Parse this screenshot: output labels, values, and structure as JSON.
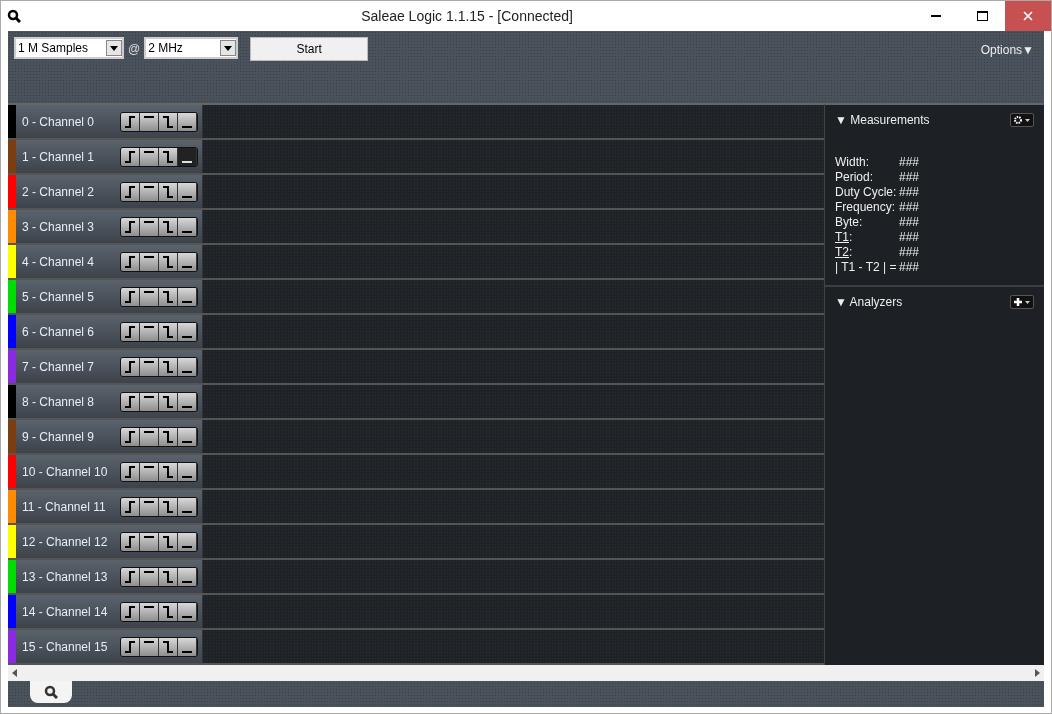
{
  "window": {
    "title": "Saleae Logic 1.1.15 - [Connected]"
  },
  "toolbar": {
    "samples": "1 M Samples",
    "at": "@",
    "rate": "2 MHz",
    "start": "Start",
    "options": "Options▼"
  },
  "channels": [
    {
      "label": "0 - Channel 0",
      "color": "#000000",
      "triggers": [
        false,
        false,
        false,
        false
      ]
    },
    {
      "label": "1 - Channel 1",
      "color": "#7a3e12",
      "triggers": [
        false,
        false,
        false,
        true
      ]
    },
    {
      "label": "2 - Channel 2",
      "color": "#ff0000",
      "triggers": [
        false,
        false,
        false,
        false
      ]
    },
    {
      "label": "3 - Channel 3",
      "color": "#ff8c00",
      "triggers": [
        false,
        false,
        false,
        false
      ]
    },
    {
      "label": "4 - Channel 4",
      "color": "#ffff00",
      "triggers": [
        false,
        false,
        false,
        false
      ]
    },
    {
      "label": "5 - Channel 5",
      "color": "#00dd00",
      "triggers": [
        false,
        false,
        false,
        false
      ]
    },
    {
      "label": "6 - Channel 6",
      "color": "#0000ff",
      "triggers": [
        false,
        false,
        false,
        false
      ]
    },
    {
      "label": "7 - Channel 7",
      "color": "#8a2be2",
      "triggers": [
        false,
        false,
        false,
        false
      ]
    },
    {
      "label": "8 - Channel 8",
      "color": "#000000",
      "triggers": [
        false,
        false,
        false,
        false
      ]
    },
    {
      "label": "9 - Channel 9",
      "color": "#7a3e12",
      "triggers": [
        false,
        false,
        false,
        false
      ]
    },
    {
      "label": "10 - Channel 10",
      "color": "#ff0000",
      "triggers": [
        false,
        false,
        false,
        false
      ]
    },
    {
      "label": "11 - Channel 11",
      "color": "#ff8c00",
      "triggers": [
        false,
        false,
        false,
        false
      ]
    },
    {
      "label": "12 - Channel 12",
      "color": "#ffff00",
      "triggers": [
        false,
        false,
        false,
        false
      ]
    },
    {
      "label": "13 - Channel 13",
      "color": "#00dd00",
      "triggers": [
        false,
        false,
        false,
        false
      ]
    },
    {
      "label": "14 - Channel 14",
      "color": "#0000ff",
      "triggers": [
        false,
        false,
        false,
        false
      ]
    },
    {
      "label": "15 - Channel 15",
      "color": "#8a2be2",
      "triggers": [
        false,
        false,
        false,
        false
      ]
    }
  ],
  "measurements": {
    "title": "▼ Measurements",
    "rows": [
      {
        "label": "Width:",
        "value": "###",
        "kind": "plain"
      },
      {
        "label": "Period:",
        "value": "###",
        "kind": "plain"
      },
      {
        "label": "Duty Cycle:",
        "value": "###",
        "kind": "plain"
      },
      {
        "label": "Frequency:",
        "value": "###",
        "kind": "plain"
      },
      {
        "label": "Byte:",
        "value": "###",
        "kind": "plain"
      },
      {
        "label": "T1",
        "suffix": ":",
        "value": "###",
        "kind": "link"
      },
      {
        "label": "T2",
        "suffix": ":",
        "value": "###",
        "kind": "link"
      },
      {
        "label": "| T1 - T2 | =",
        "value": "###",
        "kind": "plain"
      }
    ]
  },
  "analyzers": {
    "title": "▼ Analyzers"
  }
}
